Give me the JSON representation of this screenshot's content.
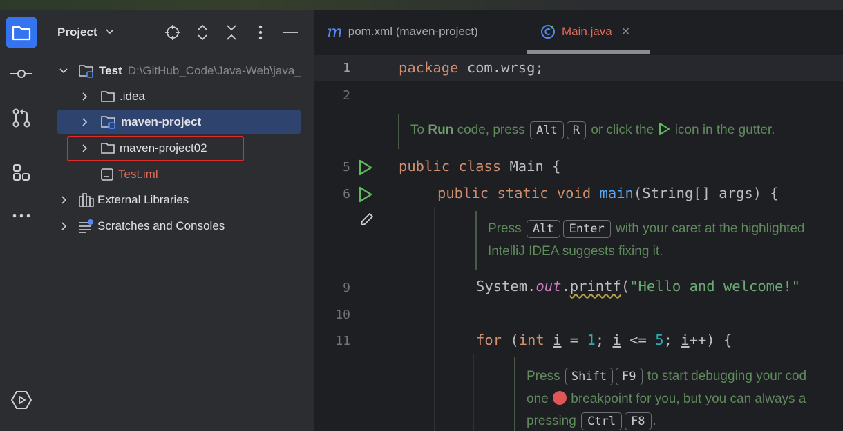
{
  "project_panel": {
    "title": "Project",
    "tree": [
      {
        "label": "Test",
        "path": "D:\\GitHub_Code\\Java-Web\\java_"
      },
      {
        "label": ".idea"
      },
      {
        "label": "maven-project"
      },
      {
        "label": "maven-project02"
      },
      {
        "label": "Test.iml"
      },
      {
        "label": "External Libraries"
      },
      {
        "label": "Scratches and Consoles"
      }
    ]
  },
  "tabs": [
    {
      "label": "pom.xml (maven-project)",
      "icon": "maven-m-icon"
    },
    {
      "label": "Main.java",
      "icon": "java-class-icon",
      "close": "×"
    }
  ],
  "line_numbers": [
    "1",
    "2",
    "5",
    "6",
    "9",
    "10",
    "11"
  ],
  "code": {
    "l1_kw": "package",
    "l1_rest": " com.wrsg;",
    "l5_kw": "public class",
    "l5_rest": " Main {",
    "l6_kw": "public static void",
    "l6_fn": "main",
    "l6_rest": "(String[] args) {",
    "l9_a": "System.",
    "l9_field": "out",
    "l9_dot": ".",
    "l9_fn": "printf",
    "l9_paren": "(",
    "l9_str": "\"Hello and welcome!\"",
    "l11_for": "for",
    "l11_p1": " (",
    "l11_int": "int",
    "l11_sp": " ",
    "l11_i1": "i",
    "l11_eq": " = ",
    "l11_n1": "1",
    "l11_semi1": "; ",
    "l11_i2": "i",
    "l11_le": " <= ",
    "l11_n5": "5",
    "l11_semi2": "; ",
    "l11_i3": "i",
    "l11_tail": "++) {"
  },
  "hints": {
    "run": {
      "t1": "To ",
      "bold": "Run",
      "t2": " code, press ",
      "k1": "Alt",
      "k2": "R",
      "t3": " or click the ",
      "t4": " icon in the gutter."
    },
    "fix": {
      "t1": "Press ",
      "k1": "Alt",
      "k2": "Enter",
      "t2": " with your caret at the highlighted",
      "line2": "IntelliJ IDEA suggests fixing it."
    },
    "debug": {
      "t1": "Press ",
      "k1": "Shift",
      "k2": "F9",
      "t2": " to start debugging your cod",
      "line2a": "one ",
      "line2b": " breakpoint for you, but you can always a",
      "line3a": "pressing ",
      "k3": "Ctrl",
      "k4": "F8",
      "line3b": "."
    }
  },
  "colors": {
    "accent": "#3574f0",
    "selection": "#2e436e",
    "highlight_box": "#e12c2c",
    "breakpoint": "#e05555",
    "run": "#5fb85b"
  }
}
